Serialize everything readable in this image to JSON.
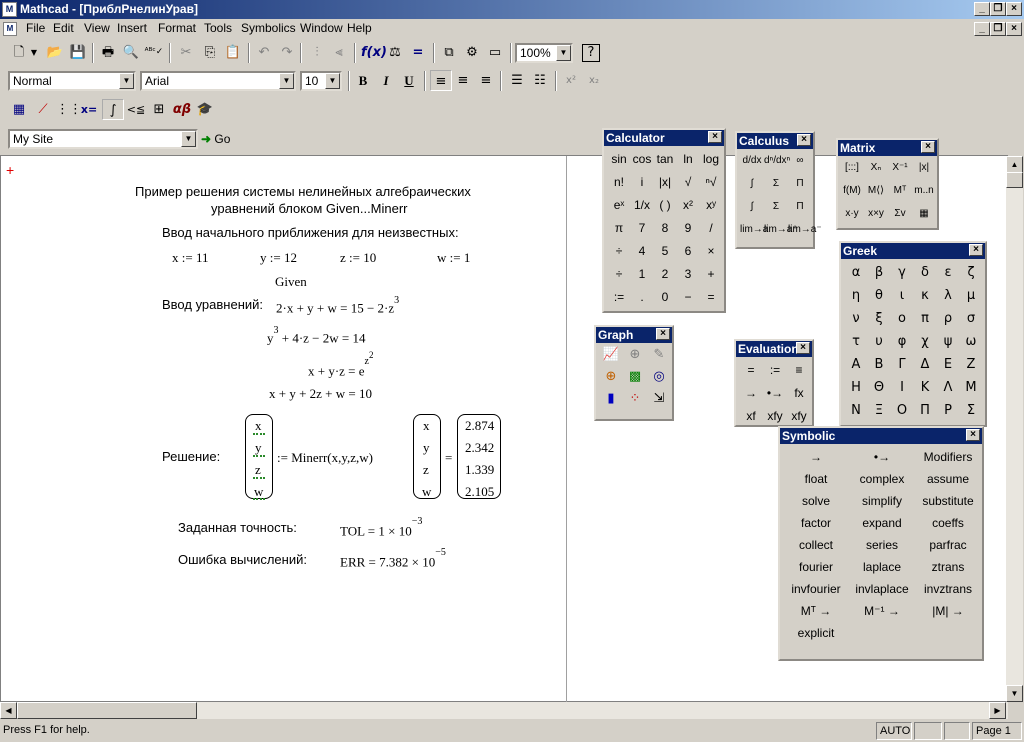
{
  "window": {
    "title": "Mathcad - [ПриблРнелинУрав]",
    "app_icon": "mathcad-icon"
  },
  "menu": [
    "File",
    "Edit",
    "View",
    "Insert",
    "Format",
    "Tools",
    "Symbolics",
    "Window",
    "Help"
  ],
  "toolbar": {
    "zoom": "100%"
  },
  "format_bar": {
    "style": "Normal",
    "font": "Arial",
    "size": "10"
  },
  "resources_bar": {
    "site": "My Site",
    "go_label": "Go"
  },
  "worksheet": {
    "title_line1": "Пример решения системы нелинейных алгебраических",
    "title_line2": "уравнений  блоком Given...Minerr",
    "initial_label": "Ввод начального приближения для неизвестных:",
    "x_init": "x := 11",
    "y_init": "y := 12",
    "z_init": "z := 10",
    "w_init": "w := 1",
    "given": "Given",
    "equations_label": "Ввод уравнений:",
    "eq1": "2·x + y + w = 15 − 2·z",
    "eq1_exp": "3",
    "eq2_base": "y",
    "eq2_exp": "3",
    "eq2_rest": "+ 4·z − 2w = 14",
    "eq3": "x + y·z = e",
    "eq3_exp": "z",
    "eq3_exp2": "2",
    "eq4": "x + y + 2z + w = 10",
    "solution_label": "Решение:",
    "vars": [
      "x",
      "y",
      "z",
      "w"
    ],
    "minerr": ":= Minerr(x,y,z,w)",
    "values": [
      "2.874",
      "2.342",
      "1.339",
      "2.105"
    ],
    "tol_label": "Заданная точность:",
    "tol_value": "TOL = 1 × 10",
    "tol_exp": "−3",
    "err_label": "Ошибка вычислений:",
    "err_value": "ERR = 7.382 × 10",
    "err_exp": "−5"
  },
  "palettes": {
    "calculator": {
      "title": "Calculator",
      "buttons": [
        "sin",
        "cos",
        "tan",
        "ln",
        "log",
        "n!",
        "i",
        "|x|",
        "√",
        "ⁿ√",
        "eˣ",
        "1/x",
        "( )",
        "x²",
        "xʸ",
        "π",
        "7",
        "8",
        "9",
        "/",
        "÷",
        "4",
        "5",
        "6",
        "×",
        "÷",
        "1",
        "2",
        "3",
        "+",
        ":=",
        ".",
        "0",
        "−",
        "="
      ]
    },
    "calculus": {
      "title": "Calculus",
      "buttons": [
        "d/dx",
        "dⁿ/dxⁿ",
        "∞",
        "∫",
        "Σ",
        "Π",
        "∫",
        "Σ",
        "Π",
        "lim→a",
        "lim→a⁺",
        "lim→a⁻"
      ]
    },
    "matrix": {
      "title": "Matrix",
      "buttons": [
        "[:::]",
        "Xₙ",
        "X⁻¹",
        "|x|",
        "f(M)",
        "M⟨⟩",
        "Mᵀ",
        "m..n",
        "x·y",
        "x×y",
        "Σv",
        "▦"
      ]
    },
    "greek": {
      "title": "Greek",
      "letters": [
        "α",
        "β",
        "γ",
        "δ",
        "ε",
        "ζ",
        "η",
        "θ",
        "ι",
        "κ",
        "λ",
        "μ",
        "ν",
        "ξ",
        "ο",
        "π",
        "ρ",
        "σ",
        "τ",
        "υ",
        "φ",
        "χ",
        "ψ",
        "ω",
        "Α",
        "Β",
        "Γ",
        "Δ",
        "Ε",
        "Ζ",
        "Η",
        "Θ",
        "Ι",
        "Κ",
        "Λ",
        "Μ",
        "Ν",
        "Ξ",
        "Ο",
        "Π",
        "Ρ",
        "Σ"
      ]
    },
    "graph": {
      "title": "Graph"
    },
    "evaluation": {
      "title": "Evaluation",
      "buttons": [
        "=",
        ":=",
        "≡",
        "→",
        "•→",
        "fx",
        "xf",
        "xfy",
        "xfy"
      ]
    },
    "symbolic": {
      "title": "Symbolic",
      "buttons": [
        "→",
        "•→",
        "Modifiers",
        "float",
        "complex",
        "assume",
        "solve",
        "simplify",
        "substitute",
        "factor",
        "expand",
        "coeffs",
        "collect",
        "series",
        "parfrac",
        "fourier",
        "laplace",
        "ztrans",
        "invfourier",
        "invlaplace",
        "invztrans",
        "Mᵀ →",
        "M⁻¹ →",
        "|M| →",
        "explicit"
      ]
    }
  },
  "status": {
    "help": "Press F1 for help.",
    "mode": "AUTO",
    "page": "Page 1"
  }
}
